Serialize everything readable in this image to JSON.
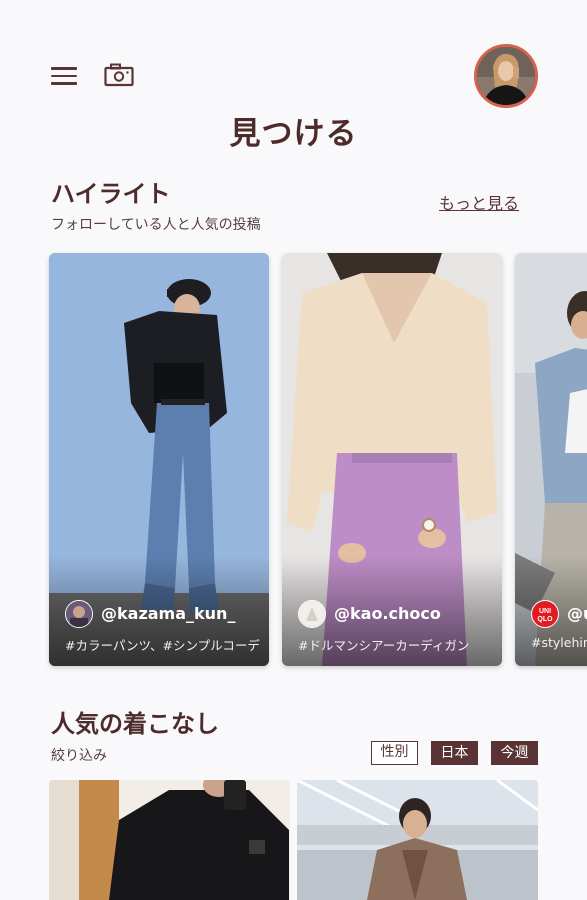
{
  "header": {
    "title": "見つける"
  },
  "highlight": {
    "title": "ハイライト",
    "subtitle": "フォローしている人と人気の投稿",
    "more_label": "もっと見る",
    "cards": [
      {
        "user": "@kazama_kun_",
        "tags": "#カラーパンツ、#シンプルコーデ"
      },
      {
        "user": "@kao.choco",
        "tags": "#ドルマンシアーカーディガン"
      },
      {
        "user": "@u",
        "tags": "#stylehin",
        "brand_badge": "UNI QLO"
      }
    ]
  },
  "popular": {
    "title": "人気の着こなし",
    "filter_label": "絞り込み",
    "chips": [
      "性別",
      "日本",
      "今週"
    ]
  },
  "colors": {
    "accent": "#5A3434",
    "avatar_ring": "#D8624E",
    "background": "#F9F9FB"
  }
}
